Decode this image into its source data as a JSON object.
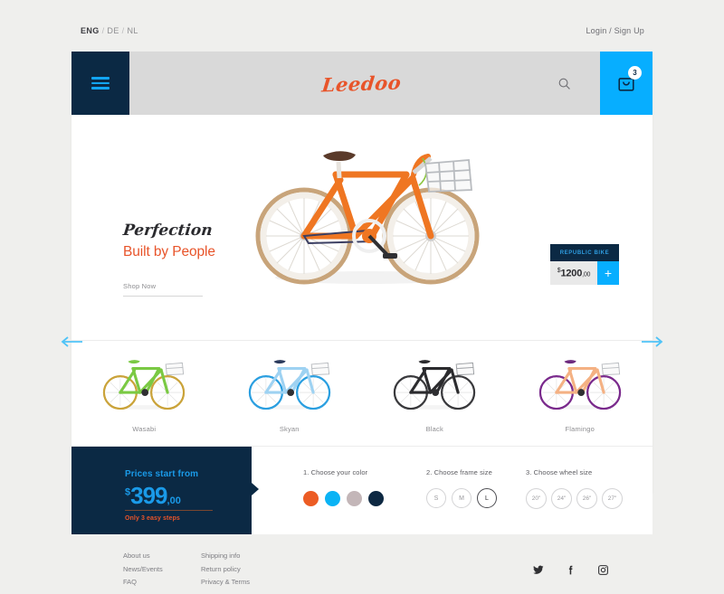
{
  "topbar": {
    "lang_active": "ENG",
    "lang_sep1": "/",
    "lang_2": "DE",
    "lang_sep2": "/",
    "lang_3": "NL",
    "account": "Login / Sign Up"
  },
  "header": {
    "logo": "Leedoo",
    "menu_icon": "hamburger-icon",
    "search_icon": "search-icon",
    "cart_icon": "shopping-bag-icon",
    "cart_count": "3",
    "accent_blue": "#07aeff",
    "navy": "#0b2944"
  },
  "hero": {
    "script_line": "Perfection",
    "title_line": "Built by People",
    "cta": "Shop Now",
    "product_image": "orange-city-bike"
  },
  "price_box": {
    "title": "REPUBLIC BIKE",
    "currency": "$",
    "amount": "1200",
    "cents": ",00",
    "add_label": "+"
  },
  "carousel": {
    "prev": "prev-arrow",
    "next": "next-arrow",
    "items": [
      {
        "label": "Wasabi",
        "frame": "#7ac943",
        "rim": "#caa33a"
      },
      {
        "label": "Skyan",
        "frame": "#9ed2f2",
        "rim": "#2b9fe0"
      },
      {
        "label": "Black",
        "frame": "#2b2b2e",
        "rim": "#3a3a3d"
      },
      {
        "label": "Flamingo",
        "frame": "#f4b183",
        "rim": "#7a2a8c"
      }
    ]
  },
  "configurator": {
    "price_label": "Prices start from",
    "currency": "$",
    "amount": "399",
    "cents": ",00",
    "steps_note": "Only 3 easy steps",
    "step1": {
      "label": "1. Choose your color",
      "colors": [
        "#ec5c24",
        "#0ab3f5",
        "#c3b6b8",
        "#0d2842"
      ]
    },
    "step2": {
      "label": "2. Choose frame size",
      "options": [
        "S",
        "M",
        "L"
      ],
      "selected": "L"
    },
    "step3": {
      "label": "3. Choose wheel size",
      "options": [
        "20\"",
        "24\"",
        "26\"",
        "27\""
      ]
    }
  },
  "footer": {
    "col1": [
      "About us",
      "News/Events",
      "FAQ"
    ],
    "col2": [
      "Shipping info",
      "Return policy",
      "Privacy & Terms"
    ],
    "social": [
      "twitter-icon",
      "facebook-icon",
      "instagram-icon"
    ]
  }
}
